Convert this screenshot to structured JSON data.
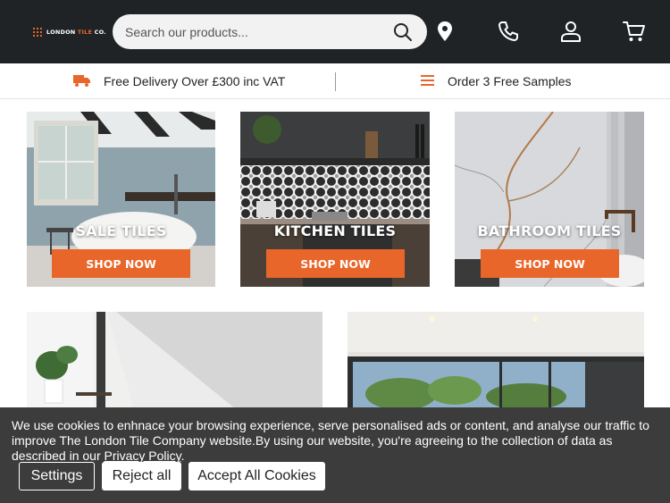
{
  "header": {
    "logo": {
      "brand": "LONDON",
      "accent": "TILE",
      "suffix": "CO."
    },
    "search": {
      "placeholder": "Search our products..."
    },
    "icons": [
      "search-icon",
      "location-pin-icon",
      "phone-icon",
      "account-icon",
      "cart-icon"
    ]
  },
  "infobar": {
    "delivery_text": "Free Delivery Over £300 inc VAT",
    "samples_text": "Order 3 Free Samples"
  },
  "categories": [
    {
      "title": "SALE TILES",
      "button": "SHOP NOW"
    },
    {
      "title": "KITCHEN TILES",
      "button": "SHOP NOW"
    },
    {
      "title": "BATHROOM TILES",
      "button": "SHOP NOW"
    }
  ],
  "cookie": {
    "text": "We use cookies to enhnace your browsing experience, serve personalised ads or content, and analyse our traffic to improve The London Tile Company website.By using our website, you're agreeing to the collection of data as described in our ",
    "link": "Privacy Policy",
    "end": ".",
    "settings_label": "Settings",
    "reject_label": "Reject all",
    "accept_label": "Accept All Cookies"
  },
  "colors": {
    "accent": "#e8662a",
    "header_bg": "#1f2326",
    "cookie_bg": "#3c3c3c"
  }
}
